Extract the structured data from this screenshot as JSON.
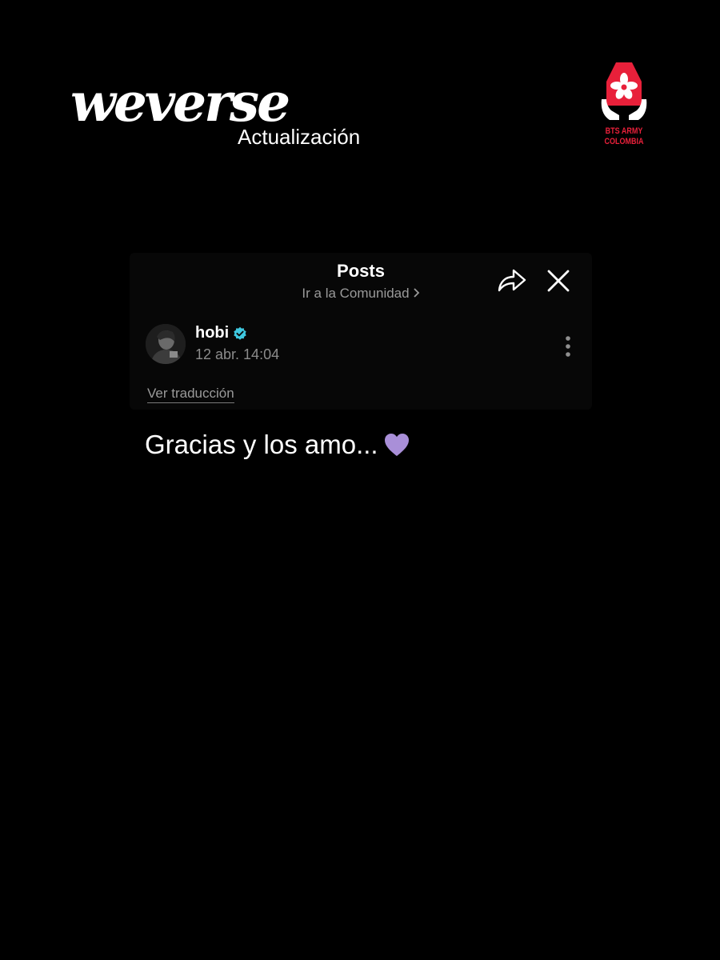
{
  "branding": {
    "wordmark": "weverse",
    "subtitle": "Actualización",
    "partner_logo": {
      "line1": "BTS ARMY",
      "line2": "COLOMBIA",
      "color": "#e8203a",
      "icon": "flower-hands-icon"
    }
  },
  "panel": {
    "title": "Posts",
    "community_link": "Ir a la Comunidad",
    "share_icon": "share-arrow-icon",
    "close_icon": "close-icon"
  },
  "post": {
    "author": "hobi",
    "verified": true,
    "verified_color": "#3fc8e0",
    "timestamp": "12 abr. 14:04",
    "translate_label": "Ver traducción",
    "body": "Gracias y los amo...",
    "emoji": "purple-heart-icon",
    "emoji_color": "#a98fd8"
  },
  "colors": {
    "background": "#000000",
    "panel": "#070707",
    "muted_text": "#9a9a9a"
  }
}
